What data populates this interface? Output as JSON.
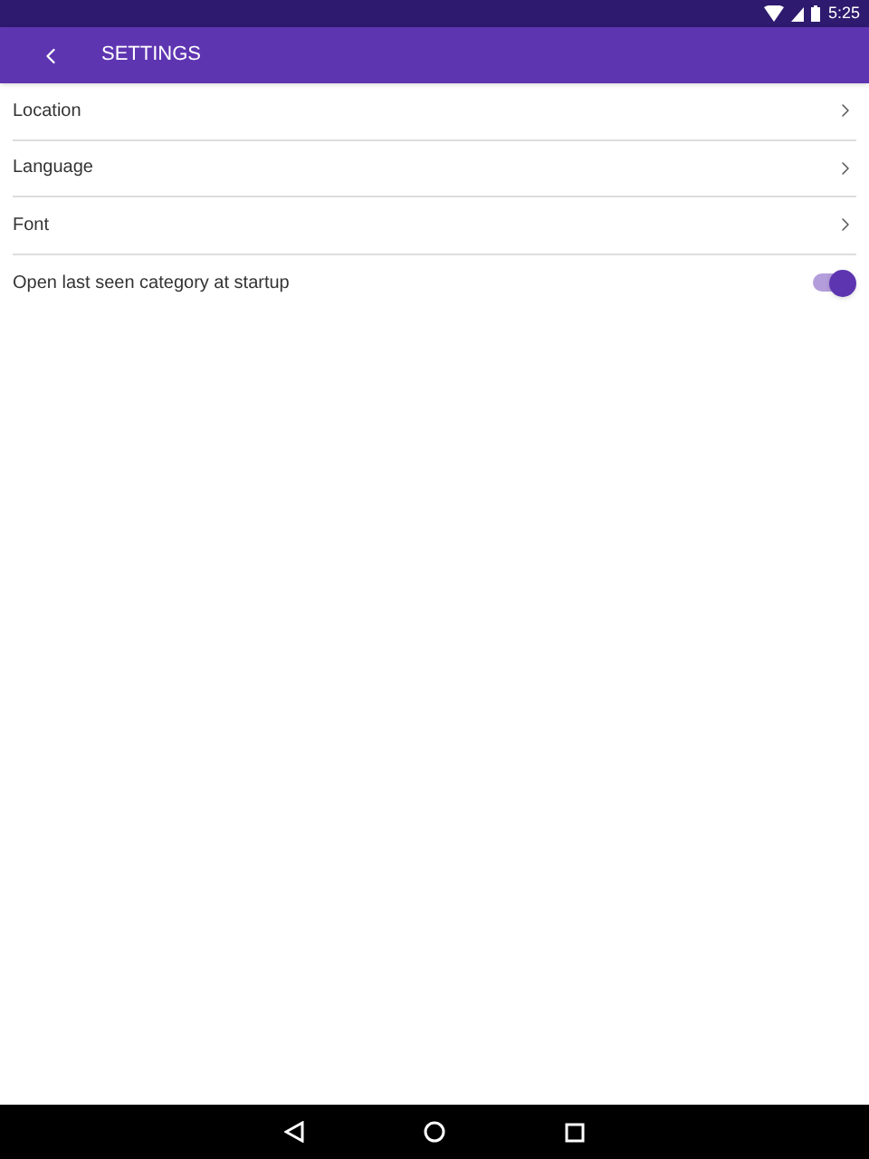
{
  "status_bar": {
    "time": "5:25"
  },
  "toolbar": {
    "title": "SETTINGS"
  },
  "items": [
    {
      "kind": "link",
      "label": "Location"
    },
    {
      "kind": "link",
      "label": "Language"
    },
    {
      "kind": "link",
      "label": "Font"
    },
    {
      "kind": "switch",
      "label": "Open last seen category at startup",
      "on": true
    }
  ]
}
